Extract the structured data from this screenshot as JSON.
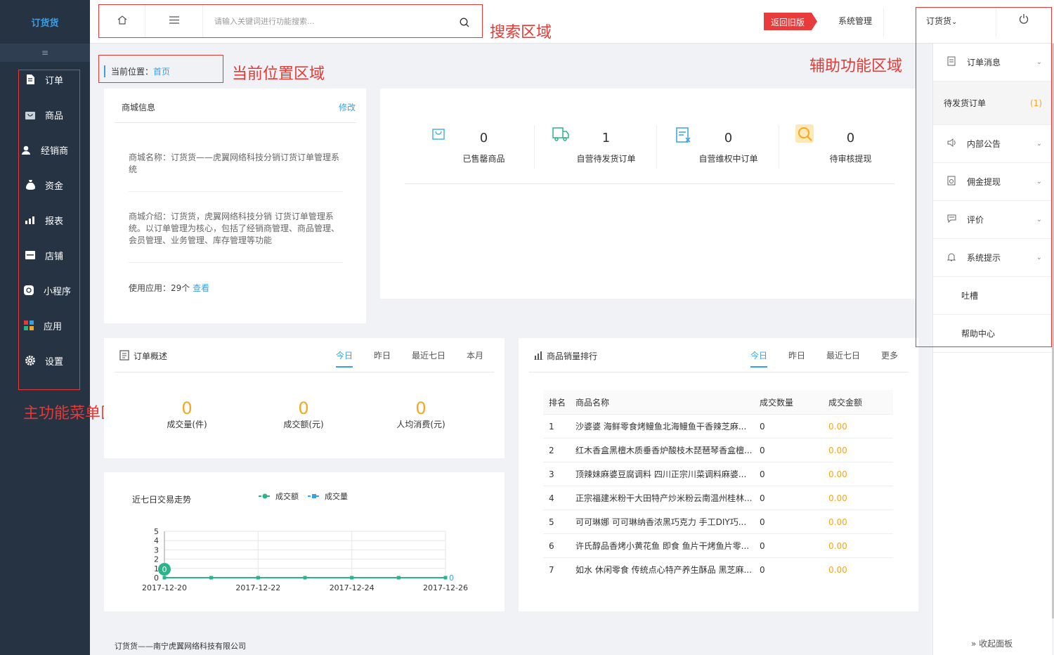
{
  "sidebar": {
    "logo": "订货货",
    "collapse_icon": "≡",
    "items": [
      {
        "label": "订单",
        "icon": "document-icon"
      },
      {
        "label": "商品",
        "icon": "box-icon"
      },
      {
        "label": "经销商",
        "icon": "user-icon"
      },
      {
        "label": "资金",
        "icon": "money-bag-icon"
      },
      {
        "label": "报表",
        "icon": "bar-chart-icon"
      },
      {
        "label": "店铺",
        "icon": "store-icon"
      },
      {
        "label": "小程序",
        "icon": "miniprogram-icon"
      },
      {
        "label": "应用",
        "icon": "apps-icon"
      },
      {
        "label": "设置",
        "icon": "gear-icon"
      }
    ]
  },
  "topbar": {
    "search_placeholder": "请输入关键词进行功能搜索...",
    "back_old": "返回旧版",
    "system_manage": "系统管理",
    "account": "订货货",
    "account_arrow": "⌄",
    "power_icon": "⏻"
  },
  "annotations": {
    "search": "搜索区域",
    "location": "当前位置区域",
    "assist": "辅助功能区域",
    "menu": "主功能菜单区域"
  },
  "breadcrumb": {
    "prefix": "当前位置：",
    "current": "首页"
  },
  "shop_info": {
    "title": "商城信息",
    "edit": "修改",
    "name_line": "商城名称：订货货——虎翼网络科技分销订货订单管理系统",
    "intro_line": "商城介绍：订货货，虎翼网络科技分销 订货订单管理系统。以订单管理为核心，包括了经销商管理、商品管理、会员管理、业务管理、库存管理等功能",
    "apps_prefix": "使用应用：29个 ",
    "apps_link": "查看"
  },
  "stats": [
    {
      "value": "0",
      "label": "已售罄商品",
      "icon": "bag-icon"
    },
    {
      "value": "1",
      "label": "自营待发货订单",
      "icon": "truck-icon"
    },
    {
      "value": "0",
      "label": "自营维权中订单",
      "icon": "dispute-icon"
    },
    {
      "value": "0",
      "label": "待审核提现",
      "icon": "withdraw-icon"
    }
  ],
  "order_overview": {
    "title": "订单概述",
    "tabs": [
      "今日",
      "昨日",
      "最近七日",
      "本月"
    ],
    "metrics": [
      {
        "value": "0",
        "label": "成交量(件)"
      },
      {
        "value": "0",
        "label": "成交额(元)"
      },
      {
        "value": "0",
        "label": "人均消费(元)"
      }
    ]
  },
  "trend": {
    "title": "近七日交易走势"
  },
  "chart_data": {
    "type": "line",
    "x": [
      "2017-12-20",
      "2017-12-21",
      "2017-12-22",
      "2017-12-23",
      "2017-12-24",
      "2017-12-25",
      "2017-12-26"
    ],
    "xticks": [
      "2017-12-20",
      "2017-12-22",
      "2017-12-24",
      "2017-12-26"
    ],
    "series": [
      {
        "name": "成交额",
        "values": [
          0,
          0,
          0,
          0,
          0,
          0,
          0
        ],
        "color": "#2bb38c"
      },
      {
        "name": "成交量",
        "values": [
          0,
          0,
          0,
          0,
          0,
          0,
          0
        ],
        "color": "#3aa0e6"
      }
    ],
    "ylim": [
      0,
      5
    ],
    "yticks": [
      "0",
      "1",
      "2",
      "3",
      "4",
      "5"
    ],
    "grid": true,
    "legend": "top",
    "point_labels": [
      "0",
      "0"
    ]
  },
  "ranking": {
    "title": "商品销量排行",
    "tabs": [
      "今日",
      "昨日",
      "最近七日",
      "更多"
    ],
    "headers": [
      "排名",
      "商品名称",
      "成交数量",
      "成交金额"
    ],
    "rows": [
      [
        "1",
        "沙婆婆 海鲜零食烤鳗鱼北海鳗鱼干香辣芝麻...",
        "0",
        "0.00"
      ],
      [
        "2",
        "红木香盒黑檀木质垂香炉酸枝木琵琶琴香盒檀...",
        "0",
        "0.00"
      ],
      [
        "3",
        "顶辣妹麻婆豆腐调料 四川正宗川菜调料麻婆...",
        "0",
        "0.00"
      ],
      [
        "4",
        "正宗福建米粉干大田特产炒米粉云南温州桂林...",
        "0",
        "0.00"
      ],
      [
        "5",
        "可可琳娜 可可琳纳香浓黑巧克力 手工DIY巧...",
        "0",
        "0.00"
      ],
      [
        "6",
        "许氏醇品香烤小黄花鱼 即食 鱼片干烤鱼片零...",
        "0",
        "0.00"
      ],
      [
        "7",
        "如水 休闲零食 传统点心特产养生酥品 黑芝麻...",
        "0",
        "0.00"
      ]
    ]
  },
  "right_panel": {
    "items": [
      {
        "label": "订单消息",
        "icon": "doc-icon",
        "chev": "⌄"
      },
      {
        "label": "待发货订单",
        "badge": "(1)"
      },
      {
        "label": "内部公告",
        "icon": "speaker-icon",
        "chev": "⌄"
      },
      {
        "label": "佣金提现",
        "icon": "receipt-icon",
        "chev": "⌄"
      },
      {
        "label": "评价",
        "icon": "comment-icon",
        "chev": "⌄"
      },
      {
        "label": "系统提示",
        "icon": "bell-icon",
        "chev": "⌄"
      },
      {
        "label": "吐槽"
      },
      {
        "label": "帮助中心"
      }
    ],
    "collapse": "» 收起面板"
  },
  "footer": "订货货——南宁虎翼网络科技有限公司"
}
